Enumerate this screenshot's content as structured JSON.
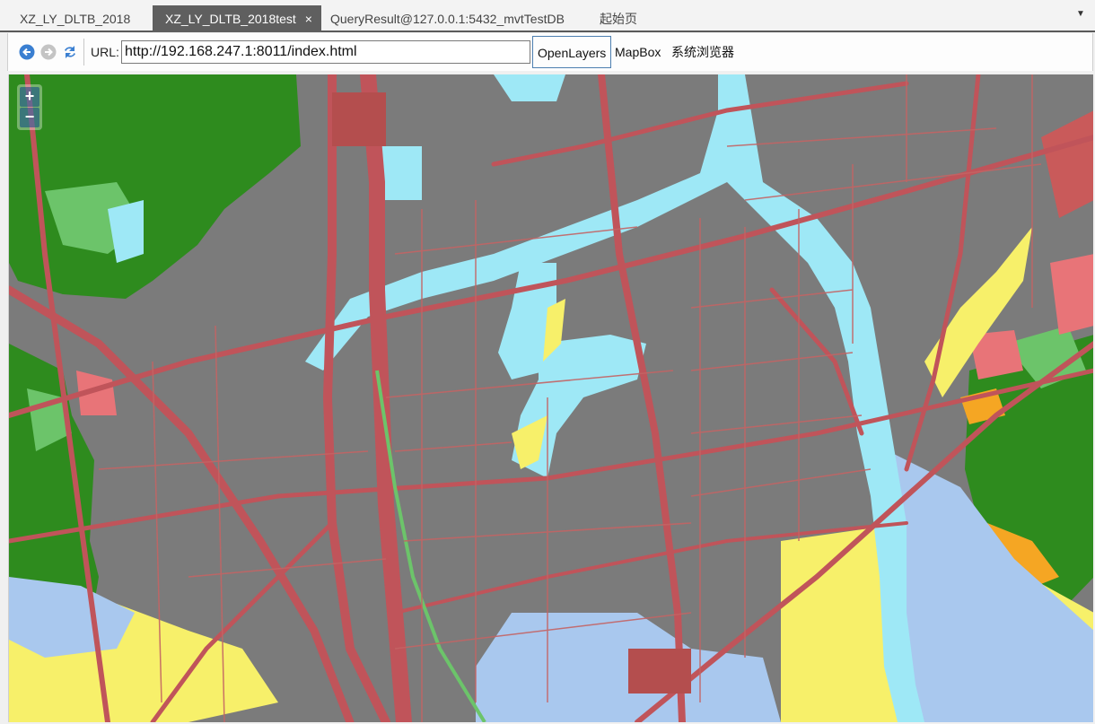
{
  "tabs": [
    {
      "label": "XZ_LY_DLTB_2018",
      "active": false
    },
    {
      "label": "XZ_LY_DLTB_2018test",
      "active": true,
      "close": "×"
    },
    {
      "label": "QueryResult@127.0.0.1:5432_mvtTestDB",
      "active": false
    },
    {
      "label": "起始页",
      "active": false
    }
  ],
  "tab_menu_icon": "▼",
  "toolbar": {
    "back_icon": "back-arrow-icon",
    "forward_icon": "forward-arrow-icon",
    "refresh_icon": "refresh-icon",
    "url_label": "URL:",
    "url_value": "http://192.168.247.1:8011/index.html",
    "engines": [
      "OpenLayers",
      "MapBox",
      "系统浏览器"
    ],
    "selected_engine": "OpenLayers"
  },
  "map": {
    "zoom_in": "+",
    "zoom_out": "−",
    "colors": {
      "urban": "#7b7b7b",
      "road": "#c0545a",
      "forest": "#2e8b1e",
      "water": "#9ee8f6",
      "farmland": "#f7f06a",
      "residential": "#e87478",
      "grass": "#6cc46a",
      "orchard": "#f5a623",
      "pond": "#a9c8ee"
    }
  }
}
